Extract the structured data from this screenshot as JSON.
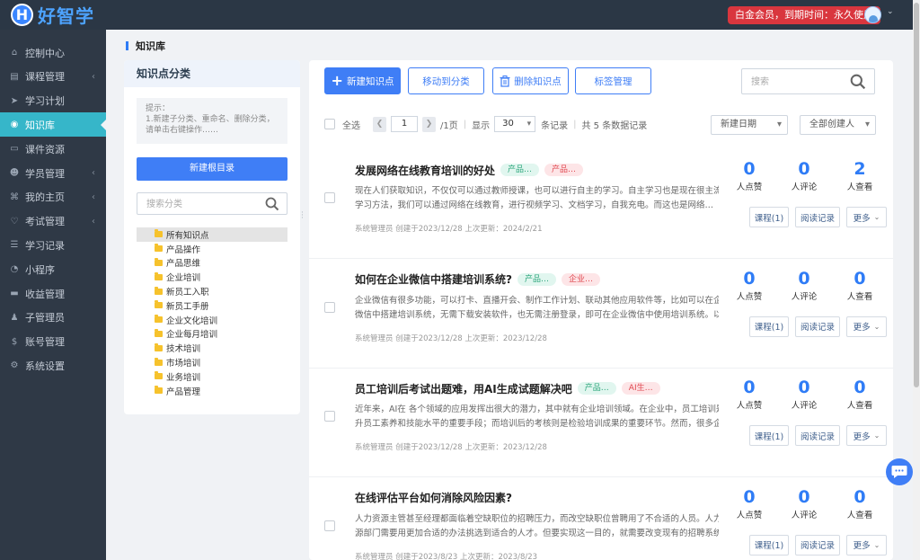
{
  "header": {
    "logo_letter": "H",
    "logo_text": "好智学",
    "vip_text": "白金会员，到期时间：永久使用"
  },
  "sidebar": {
    "items": [
      {
        "label": "控制中心",
        "icon": "home-icon",
        "has_arrow": false,
        "active": false
      },
      {
        "label": "课程管理",
        "icon": "book-icon",
        "has_arrow": true,
        "active": false
      },
      {
        "label": "学习计划",
        "icon": "send-icon",
        "has_arrow": false,
        "active": false
      },
      {
        "label": "知识库",
        "icon": "eye-icon",
        "has_arrow": false,
        "active": true
      },
      {
        "label": "课件资源",
        "icon": "folder-icon",
        "has_arrow": false,
        "active": false
      },
      {
        "label": "学员管理",
        "icon": "users-icon",
        "has_arrow": true,
        "active": false
      },
      {
        "label": "我的主页",
        "icon": "graduation-icon",
        "has_arrow": true,
        "active": false
      },
      {
        "label": "考试管理",
        "icon": "heart-icon",
        "has_arrow": true,
        "active": false
      },
      {
        "label": "学习记录",
        "icon": "list-icon",
        "has_arrow": false,
        "active": false
      },
      {
        "label": "小程序",
        "icon": "wechat-icon",
        "has_arrow": false,
        "active": false
      },
      {
        "label": "收益管理",
        "icon": "card-icon",
        "has_arrow": false,
        "active": false
      },
      {
        "label": "子管理员",
        "icon": "user-tie-icon",
        "has_arrow": false,
        "active": false
      },
      {
        "label": "账号管理",
        "icon": "dollar-icon",
        "has_arrow": false,
        "active": false
      },
      {
        "label": "系统设置",
        "icon": "gear-icon",
        "has_arrow": false,
        "active": false
      }
    ]
  },
  "breadcrumb": "知识库",
  "category_panel": {
    "title": "知识点分类",
    "tip_lines": [
      "提示：",
      "1.新建子分类、重命名、删除分类，",
      "请单击右键操作……"
    ],
    "new_root_button": "新建根目录",
    "search_placeholder": "搜索分类",
    "tree": [
      {
        "label": "所有知识点",
        "selected": true
      },
      {
        "label": "产品操作",
        "selected": false
      },
      {
        "label": "产品思维",
        "selected": false
      },
      {
        "label": "企业培训",
        "selected": false
      },
      {
        "label": "新员工入职",
        "selected": false
      },
      {
        "label": "新员工手册",
        "selected": false
      },
      {
        "label": "企业文化培训",
        "selected": false
      },
      {
        "label": "企业每月培训",
        "selected": false
      },
      {
        "label": "技术培训",
        "selected": false
      },
      {
        "label": "市场培训",
        "selected": false
      },
      {
        "label": "业务培训",
        "selected": false
      },
      {
        "label": "产品管理",
        "selected": false
      }
    ]
  },
  "toolbar": {
    "new_button": "新建知识点",
    "move_button": "移动到分类",
    "delete_button": "删除知识点",
    "tag_button": "标签管理",
    "search_placeholder": "搜索"
  },
  "pager": {
    "select_all": "全选",
    "current_page": "1",
    "total_pages": "/1页",
    "show_label": "显示",
    "page_size": "30",
    "per_page_suffix": "条记录",
    "total_text": "共 5 条数据记录",
    "sort_select": "新建日期",
    "creator_select": "全部创建人"
  },
  "articles": [
    {
      "title": "发展网络在线教育培训的好处",
      "tags": [
        {
          "text": "产品…",
          "color": "green"
        },
        {
          "text": "产品…",
          "color": "red"
        }
      ],
      "desc_lines": [
        "现在人们获取知识，不仅仅可以通过教师授课，也可以进行自主的学习。自主学习也是现在很主流的",
        "学习方法，我们可以通过网络在线教育，进行视频学习、文档学习，自我充电。而这也是网络…"
      ],
      "meta": "系统管理员 创建于2023/12/28 上次更新：2024/2/21",
      "likes": "0",
      "comments": "0",
      "views": "2"
    },
    {
      "title": "如何在企业微信中搭建培训系统?",
      "tags": [
        {
          "text": "产品…",
          "color": "green"
        },
        {
          "text": "企业…",
          "color": "red"
        }
      ],
      "desc_lines": [
        "企业微信有很多功能，可以打卡、直播开会、制作工作计划、联动其他应用软件等，比如可以在企业",
        "微信中搭建培训系统，无需下载安装软件，也无需注册登录，即可在企业微信中使用培训系统。以…"
      ],
      "meta": "系统管理员 创建于2023/12/28 上次更新：2023/12/28",
      "likes": "0",
      "comments": "0",
      "views": "0"
    },
    {
      "title": "员工培训后考试出题难，用AI生成试题解决吧",
      "tags": [
        {
          "text": "产品…",
          "color": "green"
        },
        {
          "text": "AI生…",
          "color": "red"
        }
      ],
      "desc_lines": [
        "近年来，AI在 各个领域的应用发挥出很大的潜力，其中就有企业培训领域。在企业中，员工培训是提",
        "升员工素养和技能水平的重要手段；而培训后的考核则是检验培训成果的重要环节。然而，很多企…"
      ],
      "meta": "系统管理员 创建于2023/12/28 上次更新：2023/12/28",
      "likes": "0",
      "comments": "0",
      "views": "0"
    },
    {
      "title": "在线评估平台如何消除风险因素?",
      "tags": [],
      "desc_lines": [
        "人力资源主管甚至经理都面临着空缺职位的招聘压力，而改空缺职位曾聘用了不合适的人员。人力资",
        "源部门需要用更加合适的办法挑选到适合的人才。但要实现这一目的，就需要改变现有的招聘系统…"
      ],
      "meta": "系统管理员 创建于2023/8/23 上次更新：2023/8/23",
      "likes": "0",
      "comments": "0",
      "views": "0"
    }
  ],
  "article_labels": {
    "likes": "人点赞",
    "comments": "人评论",
    "views": "人查看",
    "course_button": "课程(1)",
    "read_log_button": "阅读记录",
    "more_button": "更多"
  },
  "colors": {
    "primary": "#3f7ef6",
    "sidebar_bg": "#2f3946",
    "topbar_bg": "#2b3745",
    "active_nav": "#36b6c9",
    "vip_badge": "#d9363e"
  }
}
